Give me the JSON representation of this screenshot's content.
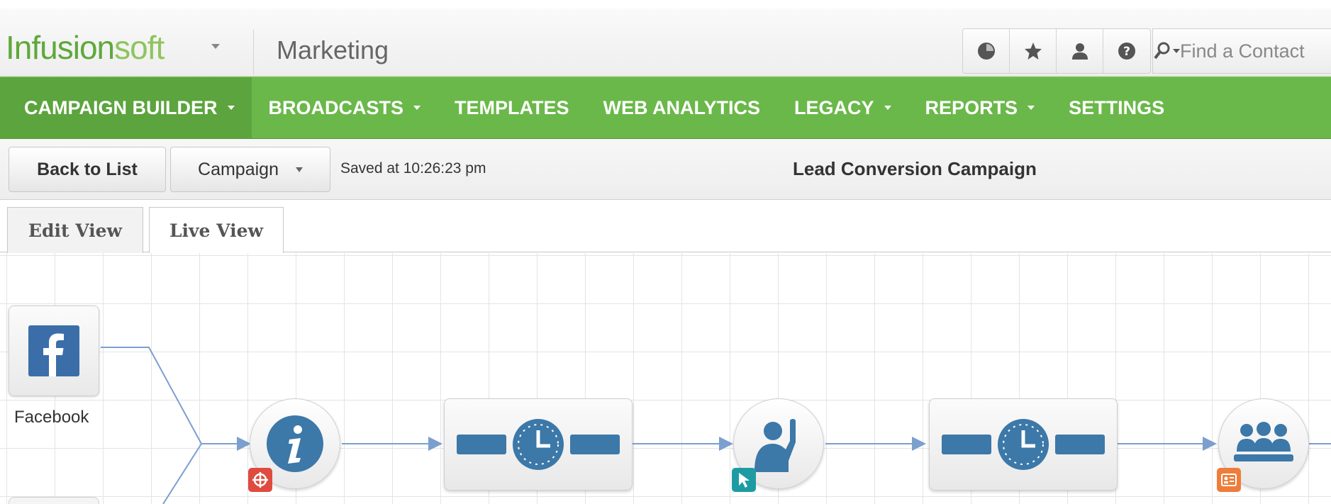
{
  "header": {
    "logo_part1": "Infusion",
    "logo_part2": "soft",
    "section": "Marketing",
    "icons": [
      "clock-icon",
      "star-icon",
      "user-icon",
      "help-icon"
    ],
    "search_placeholder": "Find a Contact"
  },
  "nav": {
    "items": [
      {
        "label": "CAMPAIGN BUILDER",
        "dropdown": true,
        "active": true
      },
      {
        "label": "BROADCASTS",
        "dropdown": true
      },
      {
        "label": "TEMPLATES",
        "dropdown": false
      },
      {
        "label": "WEB ANALYTICS",
        "dropdown": false
      },
      {
        "label": "LEGACY",
        "dropdown": true
      },
      {
        "label": "REPORTS",
        "dropdown": true
      },
      {
        "label": "SETTINGS",
        "dropdown": false
      }
    ]
  },
  "toolbar": {
    "back_label": "Back to List",
    "campaign_label": "Campaign",
    "saved_text": "Saved at 10:26:23 pm",
    "campaign_title": "Lead Conversion Campaign"
  },
  "tabs": {
    "edit": "Edit View",
    "live": "Live View"
  },
  "canvas": {
    "source_label": "Facebook",
    "nodes": [
      "facebook-source",
      "info-goal",
      "timer-sequence",
      "web-form-goal",
      "timer-sequence",
      "group-sequence"
    ]
  },
  "colors": {
    "brand_green": "#6ab84a",
    "logo_green": "#5fa83a",
    "node_blue": "#3c78a8",
    "link_blue": "#7b9fcf"
  }
}
